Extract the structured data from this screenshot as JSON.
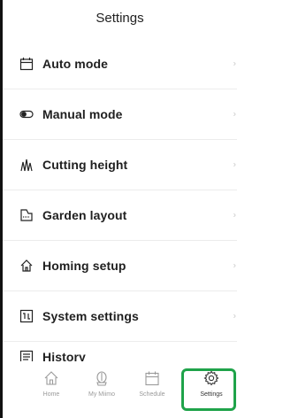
{
  "header": {
    "title": "Settings"
  },
  "menu": {
    "items": [
      {
        "label": "Auto mode",
        "icon": "calendar-icon"
      },
      {
        "label": "Manual mode",
        "icon": "toggle-icon"
      },
      {
        "label": "Cutting height",
        "icon": "grass-icon"
      },
      {
        "label": "Garden layout",
        "icon": "map-icon"
      },
      {
        "label": "Homing setup",
        "icon": "home-icon"
      },
      {
        "label": "System settings",
        "icon": "system-icon"
      },
      {
        "label": "History",
        "icon": "list-icon"
      }
    ],
    "chevron": "›"
  },
  "tabbar": {
    "tabs": [
      {
        "label": "Home",
        "icon": "home-icon"
      },
      {
        "label": "My Miimo",
        "icon": "mower-icon"
      },
      {
        "label": "Schedule",
        "icon": "calendar-icon"
      },
      {
        "label": "Settings",
        "icon": "gear-icon",
        "active": true
      }
    ]
  },
  "colors": {
    "highlight": "#1fa34a",
    "inactive": "#9a9a9a"
  }
}
